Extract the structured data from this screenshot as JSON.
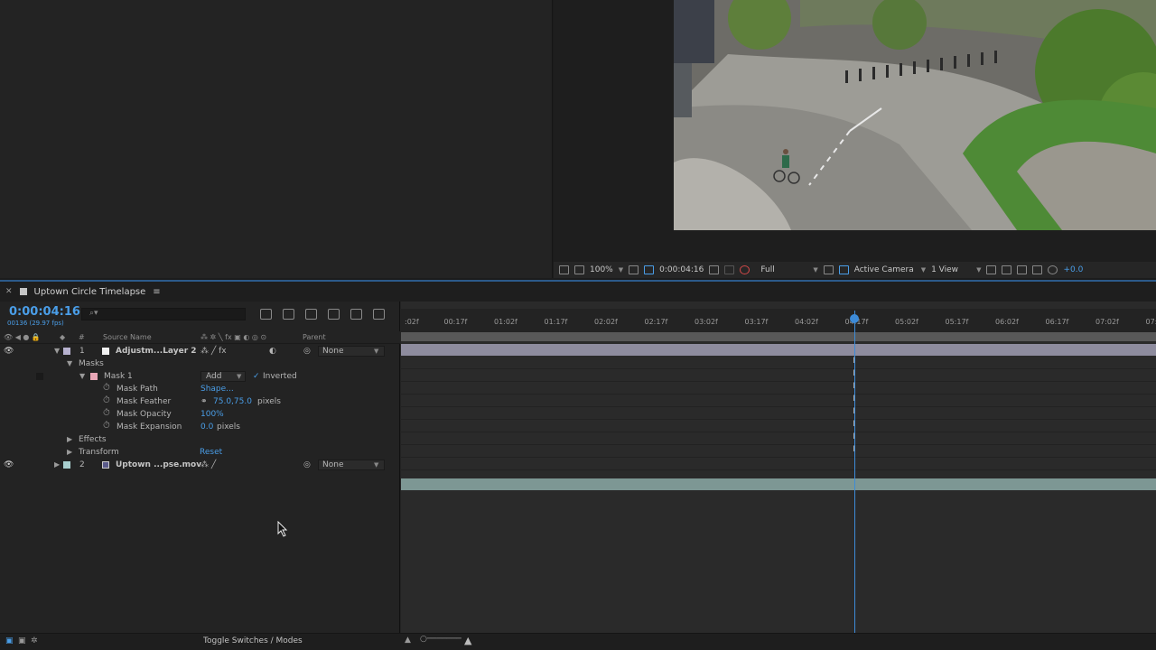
{
  "viewer": {
    "zoom": "100%",
    "timecode": "0:00:04:16",
    "resolution": "Full",
    "camera": "Active Camera",
    "view": "1 View",
    "exposure": "+0.0"
  },
  "timeline": {
    "tab_label": "Uptown Circle Timelapse",
    "timecode": "0:00:04:16",
    "fps": "00136 (29.97 fps)",
    "search_placeholder": "⌕▾",
    "headers": {
      "hash": "#",
      "source": "Source Name",
      "parent": "Parent"
    },
    "ruler": [
      ":02f",
      "00:17f",
      "01:02f",
      "01:17f",
      "02:02f",
      "02:17f",
      "03:02f",
      "03:17f",
      "04:02f",
      "04:17f",
      "05:02f",
      "05:17f",
      "06:02f",
      "06:17f",
      "07:02f",
      "07:"
    ],
    "layers": [
      {
        "num": "1",
        "name": "Adjustm...Layer 2",
        "parent": "None",
        "swatch": "#b7b2cf"
      },
      {
        "num": "2",
        "name": "Uptown ...pse.mov",
        "parent": "None",
        "swatch": "#a9cfcf"
      }
    ],
    "props": {
      "masks": "Masks",
      "mask1": "Mask 1",
      "mode": "Add",
      "inverted": "Inverted",
      "mask_path": "Mask Path",
      "mask_path_value": "Shape...",
      "mask_feather": "Mask Feather",
      "mask_feather_value": "75.0,75.0",
      "mask_feather_unit": "pixels",
      "mask_opacity": "Mask Opacity",
      "mask_opacity_value": "100%",
      "mask_expansion": "Mask Expansion",
      "mask_expansion_value": "0.0",
      "mask_expansion_unit": "pixels",
      "effects": "Effects",
      "transform": "Transform",
      "reset": "Reset"
    },
    "toggle_label": "Toggle Switches / Modes"
  }
}
